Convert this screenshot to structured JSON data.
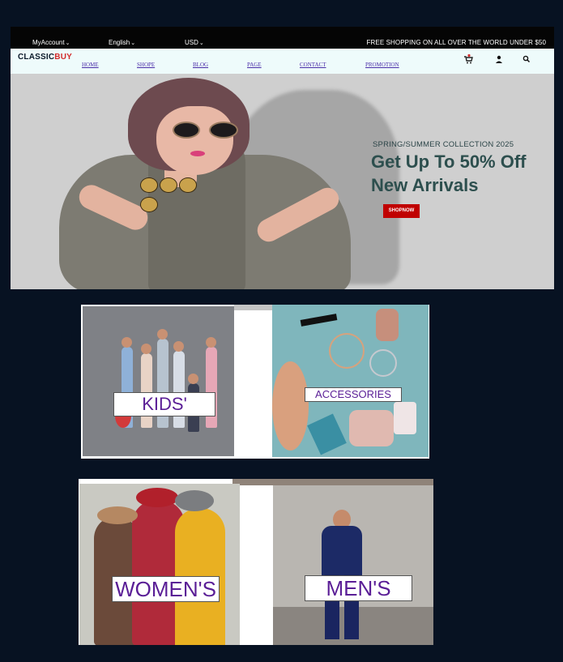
{
  "topbar": {
    "account": "MyAccount",
    "language": "English",
    "currency": "USD",
    "promo": "FREE SHOPPING ON ALL OVER THE WORLD UNDER $50"
  },
  "brand": {
    "name_part1": "CLASSIC",
    "name_part2": "BUY"
  },
  "nav": {
    "home": "HOME",
    "shope": "SHOPE",
    "blog": "BLOG",
    "page": "PAGE",
    "contact": "CONTACT",
    "promotion": "PROMOTION"
  },
  "nav_icons": [
    "cart-icon",
    "user-icon",
    "search-icon"
  ],
  "cart_count": "1",
  "hero": {
    "subtitle": "SPRING/SUMMER COLLECTION 2025",
    "headline_line1": "Get Up To 50% Off",
    "headline_line2": "New Arrivals",
    "button": "SHOPNOW"
  },
  "categories": {
    "kids": "KIDS'",
    "accessories": "ACCESSORIES",
    "womens": "WOMEN'S",
    "mens": "MEN'S"
  },
  "colors": {
    "page_bg": "#071222",
    "topbar_bg": "#050505",
    "navbar_bg": "#eefbfb",
    "brand_accent": "#d22a2a",
    "nav_link": "#4a2ca8",
    "shop_button": "#c00000",
    "category_label": "#5a1e96",
    "headline": "#2d4f4e"
  }
}
